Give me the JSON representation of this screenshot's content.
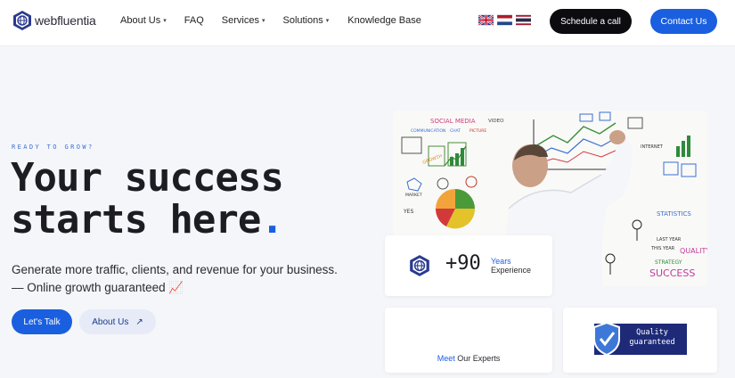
{
  "brand": {
    "name": "webfluentia",
    "logo_icon": "hexagon-globe-icon"
  },
  "nav": {
    "items": [
      {
        "label": "About Us",
        "dropdown": true
      },
      {
        "label": "FAQ",
        "dropdown": false
      },
      {
        "label": "Services",
        "dropdown": true
      },
      {
        "label": "Solutions",
        "dropdown": true
      },
      {
        "label": "Knowledge Base",
        "dropdown": false
      }
    ],
    "caret": "▾"
  },
  "languages": [
    "uk-flag-icon",
    "netherlands-flag-icon",
    "thailand-flag-icon"
  ],
  "header_buttons": {
    "schedule": "Schedule a call",
    "contact": "Contact Us"
  },
  "hero": {
    "eyebrow": "READY TO GROW?",
    "title_line1": "Your success",
    "title_line2": "starts here",
    "title_dot": ".",
    "desc_line1": "Generate more traffic, clients, and revenue for your business.",
    "desc_line2": "— Online growth guaranteed 📈",
    "cta_primary": "Let's Talk",
    "cta_secondary": "About Us",
    "cta_secondary_icon": "↗"
  },
  "image_words": {
    "social_media": "SOCIAL MEDIA",
    "video": "VIDEO",
    "communication": "COMMUNICATION",
    "chat": "CHAT",
    "picture": "PICTURE",
    "internet": "INTERNET",
    "statistics": "STATISTICS",
    "quality": "QUALITY",
    "strategy": "STRATEGY",
    "success": "SUCCESS",
    "last_year": "LAST YEAR",
    "this_year": "THIS YEAR",
    "yes": "YES",
    "growth": "GROWTH",
    "market": "MARKET"
  },
  "stats": {
    "years_value": "+90",
    "years_label": "Years",
    "years_sub": "Experience",
    "experts_highlight": "Meet",
    "experts_rest": " Our Experts",
    "quality_line1": "Quality",
    "quality_line2": "guaranteed"
  },
  "colors": {
    "accent": "#1a5fe0",
    "dark": "#0c0c10",
    "badge": "#1e2a78"
  }
}
